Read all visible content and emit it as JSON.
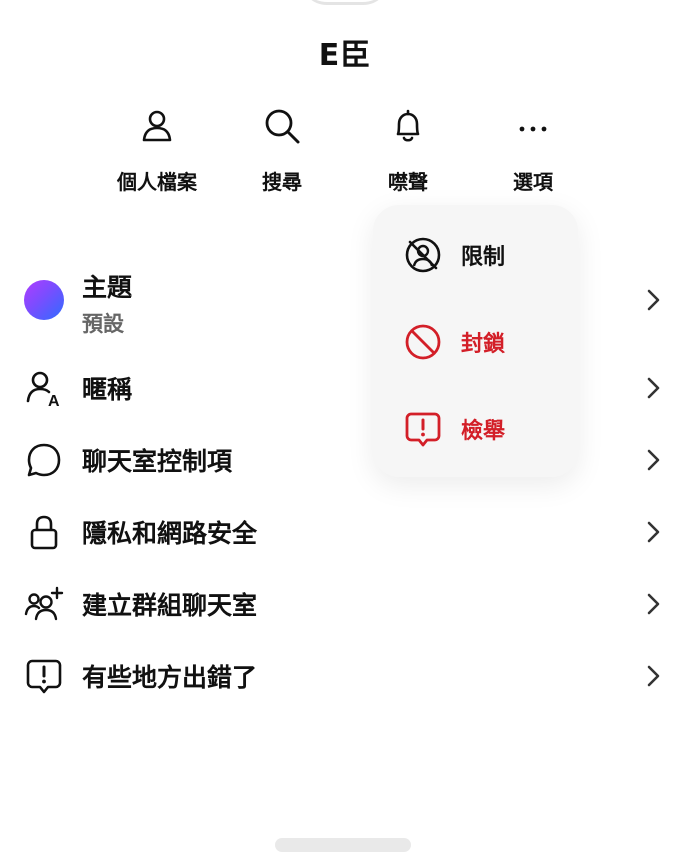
{
  "contact": {
    "name": "E臣"
  },
  "actions": [
    {
      "label": "個人檔案",
      "icon": "person-icon"
    },
    {
      "label": "搜尋",
      "icon": "search-icon"
    },
    {
      "label": "噤聲",
      "icon": "bell-icon"
    },
    {
      "label": "選項",
      "icon": "more-icon"
    }
  ],
  "options_menu": {
    "items": [
      {
        "label": "限制",
        "icon": "restrict-icon",
        "color": "#111111"
      },
      {
        "label": "封鎖",
        "icon": "block-icon",
        "color": "#d31f28"
      },
      {
        "label": "檢舉",
        "icon": "report-icon",
        "color": "#d31f28"
      }
    ]
  },
  "settings": {
    "theme": {
      "label": "主題",
      "value": "預設"
    },
    "nickname": {
      "label": "暱稱"
    },
    "chat_controls": {
      "label": "聊天室控制項"
    },
    "privacy": {
      "label": "隱私和網路安全"
    },
    "create_group": {
      "label": "建立群組聊天室"
    },
    "report_problem": {
      "label": "有些地方出錯了"
    }
  },
  "colors": {
    "accent_red": "#d31f28",
    "theme_gradient": [
      "#b03cff",
      "#2f6cff"
    ]
  }
}
